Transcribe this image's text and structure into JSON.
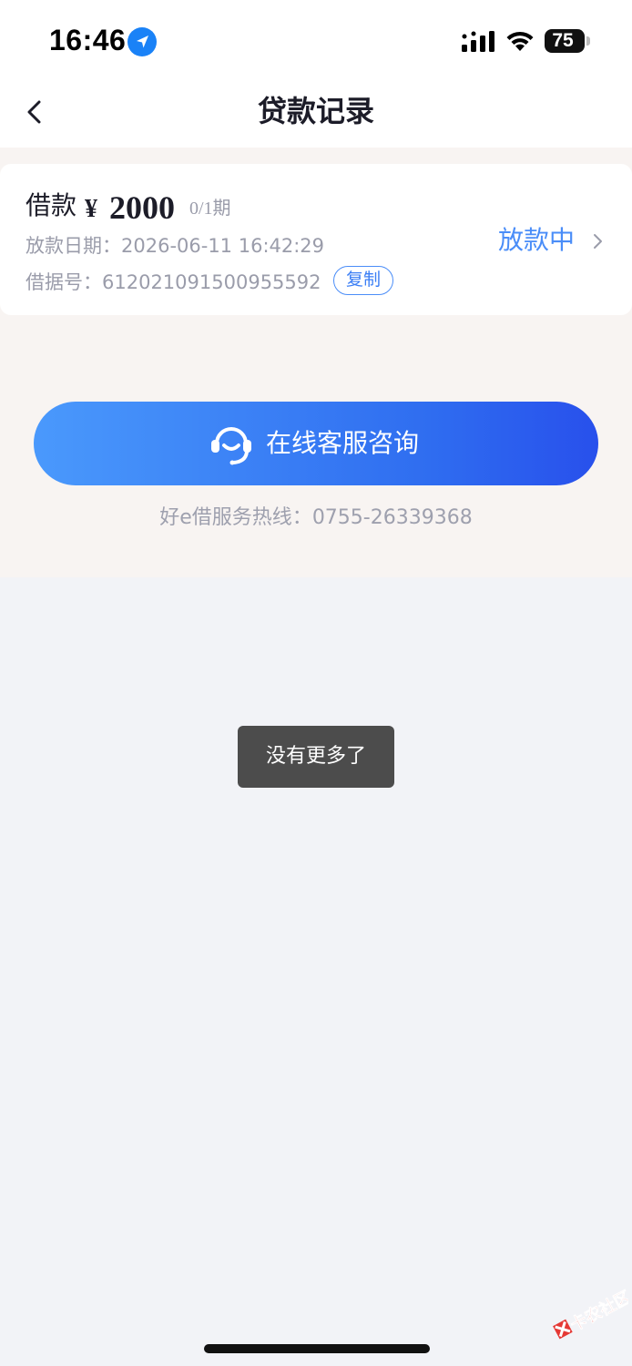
{
  "status_bar": {
    "time": "16:46",
    "battery": "75",
    "icons": [
      "location-arrow-icon",
      "signal-icon",
      "wifi-icon",
      "battery-icon"
    ]
  },
  "nav": {
    "title": "贷款记录",
    "back_icon": "chevron-left-icon"
  },
  "loan": {
    "label": "借款",
    "currency": "¥",
    "amount": "2000",
    "period": "0/1期",
    "date_label": "放款日期：",
    "date_value": "2026-06-11 16:42:29",
    "loan_no_label": "借据号：",
    "loan_no_value": "612021091500955592",
    "copy_label": "复制",
    "status": "放款中"
  },
  "service": {
    "button_label": "在线客服咨询",
    "icon": "headset-icon",
    "hotline_label": "好e借服务热线：",
    "hotline_number": "0755-26339368"
  },
  "toast": {
    "text": "没有更多了"
  },
  "watermark": {
    "text": "卡农社区"
  },
  "colors": {
    "accent": "#4a8df8",
    "button_gradient_start": "#4a99fc",
    "button_gradient_end": "#2850ec",
    "upper_bg": "#f8f4f2",
    "page_bg": "#f2f3f7"
  }
}
